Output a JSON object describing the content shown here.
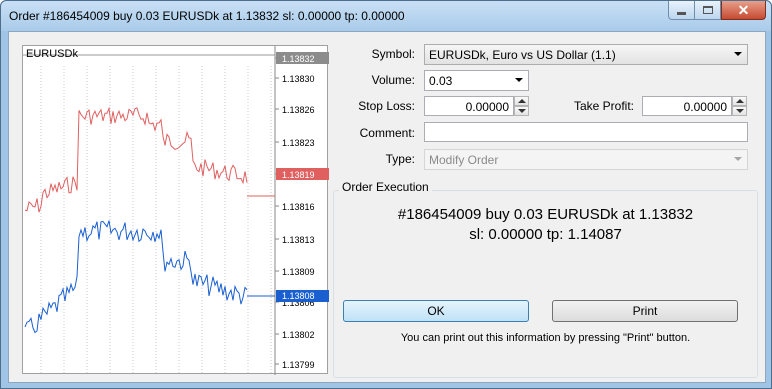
{
  "window": {
    "title": "Order #186454009 buy 0.03 EURUSDk at 1.13832 sl: 0.00000 tp: 0.00000"
  },
  "chart": {
    "symbol": "EURUSDk",
    "price_labels": [
      "1.13832",
      "1.13830",
      "1.13826",
      "1.13823",
      "1.13819",
      "1.13816",
      "1.13813",
      "1.13809",
      "1.13806",
      "1.13802",
      "1.13799"
    ],
    "last_bid_label": "1.13819",
    "last_ask_label": "1.13808",
    "colors": {
      "bid": "#e06060",
      "ask": "#1a5fd0",
      "highlight": "#8c8c8c"
    }
  },
  "form": {
    "symbol_label": "Symbol:",
    "symbol_value": "EURUSDk, Euro vs US Dollar (1.1)",
    "volume_label": "Volume:",
    "volume_value": "0.03",
    "stop_loss_label": "Stop Loss:",
    "stop_loss_value": "0.00000",
    "take_profit_label": "Take Profit:",
    "take_profit_value": "0.00000",
    "comment_label": "Comment:",
    "comment_value": "",
    "type_label": "Type:",
    "type_value": "Modify Order"
  },
  "execution": {
    "group_title": "Order Execution",
    "line1": "#186454009 buy 0.03 EURUSDk at 1.13832",
    "line2": "sl: 0.00000 tp: 1.14087",
    "ok_label": "OK",
    "print_label": "Print",
    "hint": "You can print out this information by pressing \"Print\" button."
  }
}
